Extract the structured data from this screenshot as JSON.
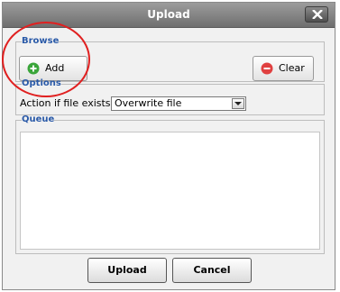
{
  "window": {
    "title": "Upload",
    "close_icon": "close-icon"
  },
  "browse": {
    "legend": "Browse",
    "add_label": "Add",
    "clear_label": "Clear"
  },
  "options": {
    "legend": "Options",
    "action_label": "Action if file exists:",
    "action_value": "Overwrite file"
  },
  "queue": {
    "legend": "Queue"
  },
  "footer": {
    "upload_label": "Upload",
    "cancel_label": "Cancel"
  },
  "colors": {
    "legend": "#2a5aa8",
    "add_icon": "#3aa53a",
    "clear_icon": "#e04040",
    "annotation": "#e02020"
  }
}
